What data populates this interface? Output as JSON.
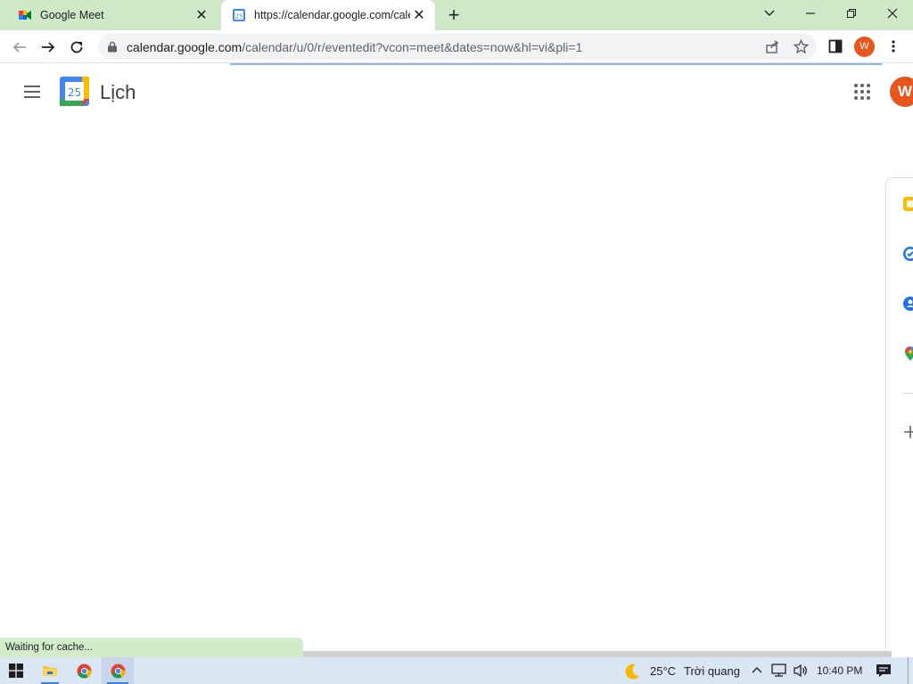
{
  "browser": {
    "tabs": [
      {
        "title": "Google Meet",
        "icon": "google-meet-icon",
        "active": false
      },
      {
        "title": "https://calendar.google.com/cale",
        "icon": "google-calendar-icon",
        "active": true
      }
    ],
    "address_bar": {
      "host": "calendar.google.com",
      "path": "/calendar/u/0/r/eventedit?vcon=meet&dates=now&hl=vi&pli=1"
    },
    "profile_initial": "W"
  },
  "app": {
    "title": "Lịch",
    "calendar_day": "25",
    "avatar_initial": "W",
    "side_panel_icons": [
      "keep-icon",
      "tasks-icon",
      "contacts-icon",
      "maps-icon",
      "add-icon"
    ]
  },
  "status_text": "Waiting for cache...",
  "taskbar": {
    "weather_temp": "25°C",
    "weather_desc": "Trời quang",
    "time": "10:40 PM"
  },
  "colors": {
    "tabstrip": "#cfe8c8",
    "accent_orange": "#e8561e",
    "calendar_blue": "#4285f4",
    "taskbar": "#dbe6f4"
  }
}
